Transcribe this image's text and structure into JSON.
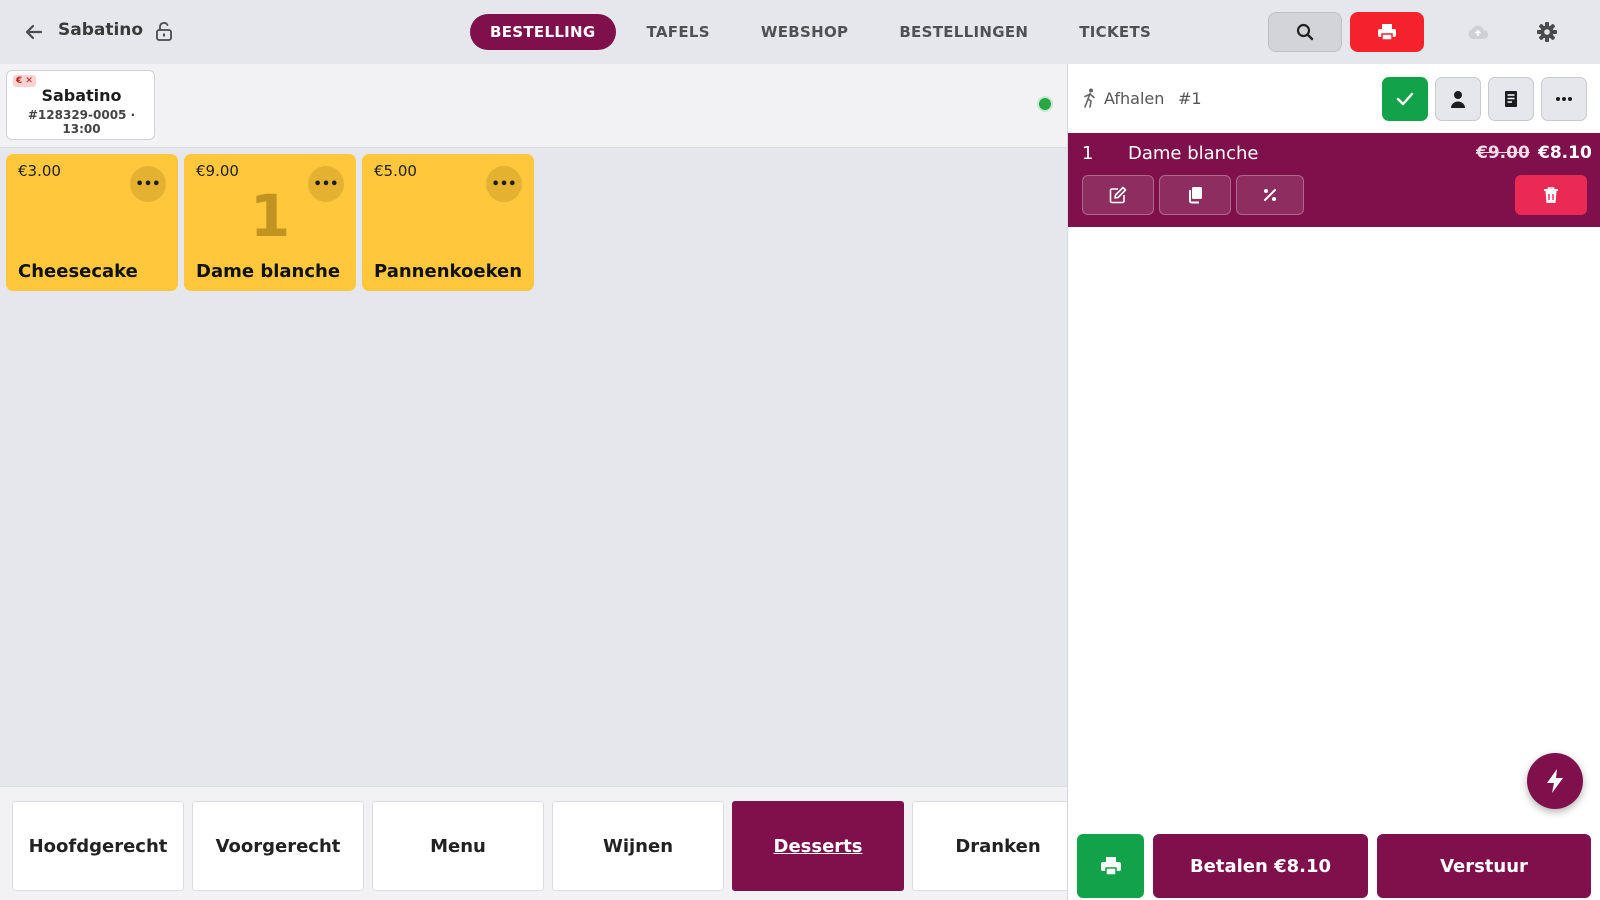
{
  "header": {
    "title": "Sabatino",
    "tabs": [
      {
        "label": "BESTELLING",
        "active": true
      },
      {
        "label": "TAFELS"
      },
      {
        "label": "WEBSHOP"
      },
      {
        "label": "BESTELLINGEN"
      },
      {
        "label": "TICKETS"
      }
    ],
    "icons": [
      "back-arrow-icon",
      "unlock-icon",
      "search-icon",
      "printer-icon",
      "cloud-upload-icon",
      "gear-icon"
    ]
  },
  "open_order": {
    "badge": "€ ✕",
    "name": "Sabatino",
    "meta": "#128329-0005 · 13:00"
  },
  "products": [
    {
      "price": "€3.00",
      "name": "Cheesecake",
      "qty": ""
    },
    {
      "price": "€9.00",
      "name": "Dame blanche",
      "qty": "1"
    },
    {
      "price": "€5.00",
      "name": "Pannenkoeken",
      "qty": ""
    }
  ],
  "categories": [
    {
      "label": "Hoofdgerecht"
    },
    {
      "label": "Voorgerecht"
    },
    {
      "label": "Menu"
    },
    {
      "label": "Wijnen"
    },
    {
      "label": "Desserts",
      "active": true
    },
    {
      "label": "Dranken"
    }
  ],
  "cart": {
    "mode": "Afhalen",
    "number": "#1",
    "items": [
      {
        "qty": "1",
        "name": "Dame blanche",
        "old_price": "€9.00",
        "price": "€8.10"
      }
    ],
    "pay_label": "Betalen €8.10",
    "send_label": "Verstuur"
  },
  "colors": {
    "brand": "#7f104b",
    "product_tile": "#fec73c",
    "success": "#12a34a",
    "danger": "#f5222d",
    "delete": "#ea2a55",
    "status_online": "#29a745"
  }
}
